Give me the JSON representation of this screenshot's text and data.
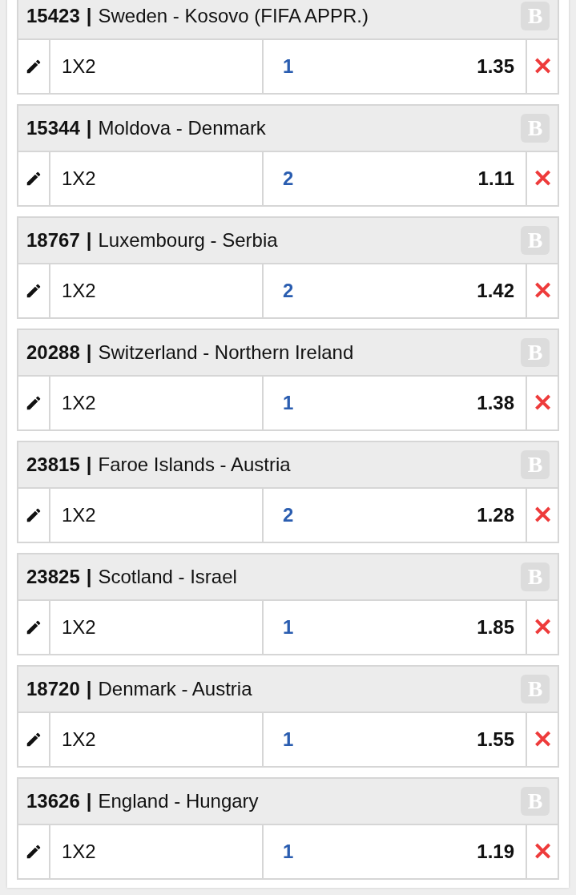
{
  "separator": "|",
  "bets": [
    {
      "code": "15423",
      "match": "Sweden - Kosovo (FIFA APPR.)",
      "badge": "B",
      "market": "1X2",
      "pick": "1",
      "odds": "1.35",
      "remove": "✕"
    },
    {
      "code": "15344",
      "match": "Moldova - Denmark",
      "badge": "B",
      "market": "1X2",
      "pick": "2",
      "odds": "1.11",
      "remove": "✕"
    },
    {
      "code": "18767",
      "match": "Luxembourg - Serbia",
      "badge": "B",
      "market": "1X2",
      "pick": "2",
      "odds": "1.42",
      "remove": "✕"
    },
    {
      "code": "20288",
      "match": "Switzerland - Northern Ireland",
      "badge": "B",
      "market": "1X2",
      "pick": "1",
      "odds": "1.38",
      "remove": "✕"
    },
    {
      "code": "23815",
      "match": "Faroe Islands - Austria",
      "badge": "B",
      "market": "1X2",
      "pick": "2",
      "odds": "1.28",
      "remove": "✕"
    },
    {
      "code": "23825",
      "match": "Scotland - Israel",
      "badge": "B",
      "market": "1X2",
      "pick": "1",
      "odds": "1.85",
      "remove": "✕"
    },
    {
      "code": "18720",
      "match": "Denmark - Austria",
      "badge": "B",
      "market": "1X2",
      "pick": "1",
      "odds": "1.55",
      "remove": "✕"
    },
    {
      "code": "13626",
      "match": "England - Hungary",
      "badge": "B",
      "market": "1X2",
      "pick": "1",
      "odds": "1.19",
      "remove": "✕"
    }
  ]
}
